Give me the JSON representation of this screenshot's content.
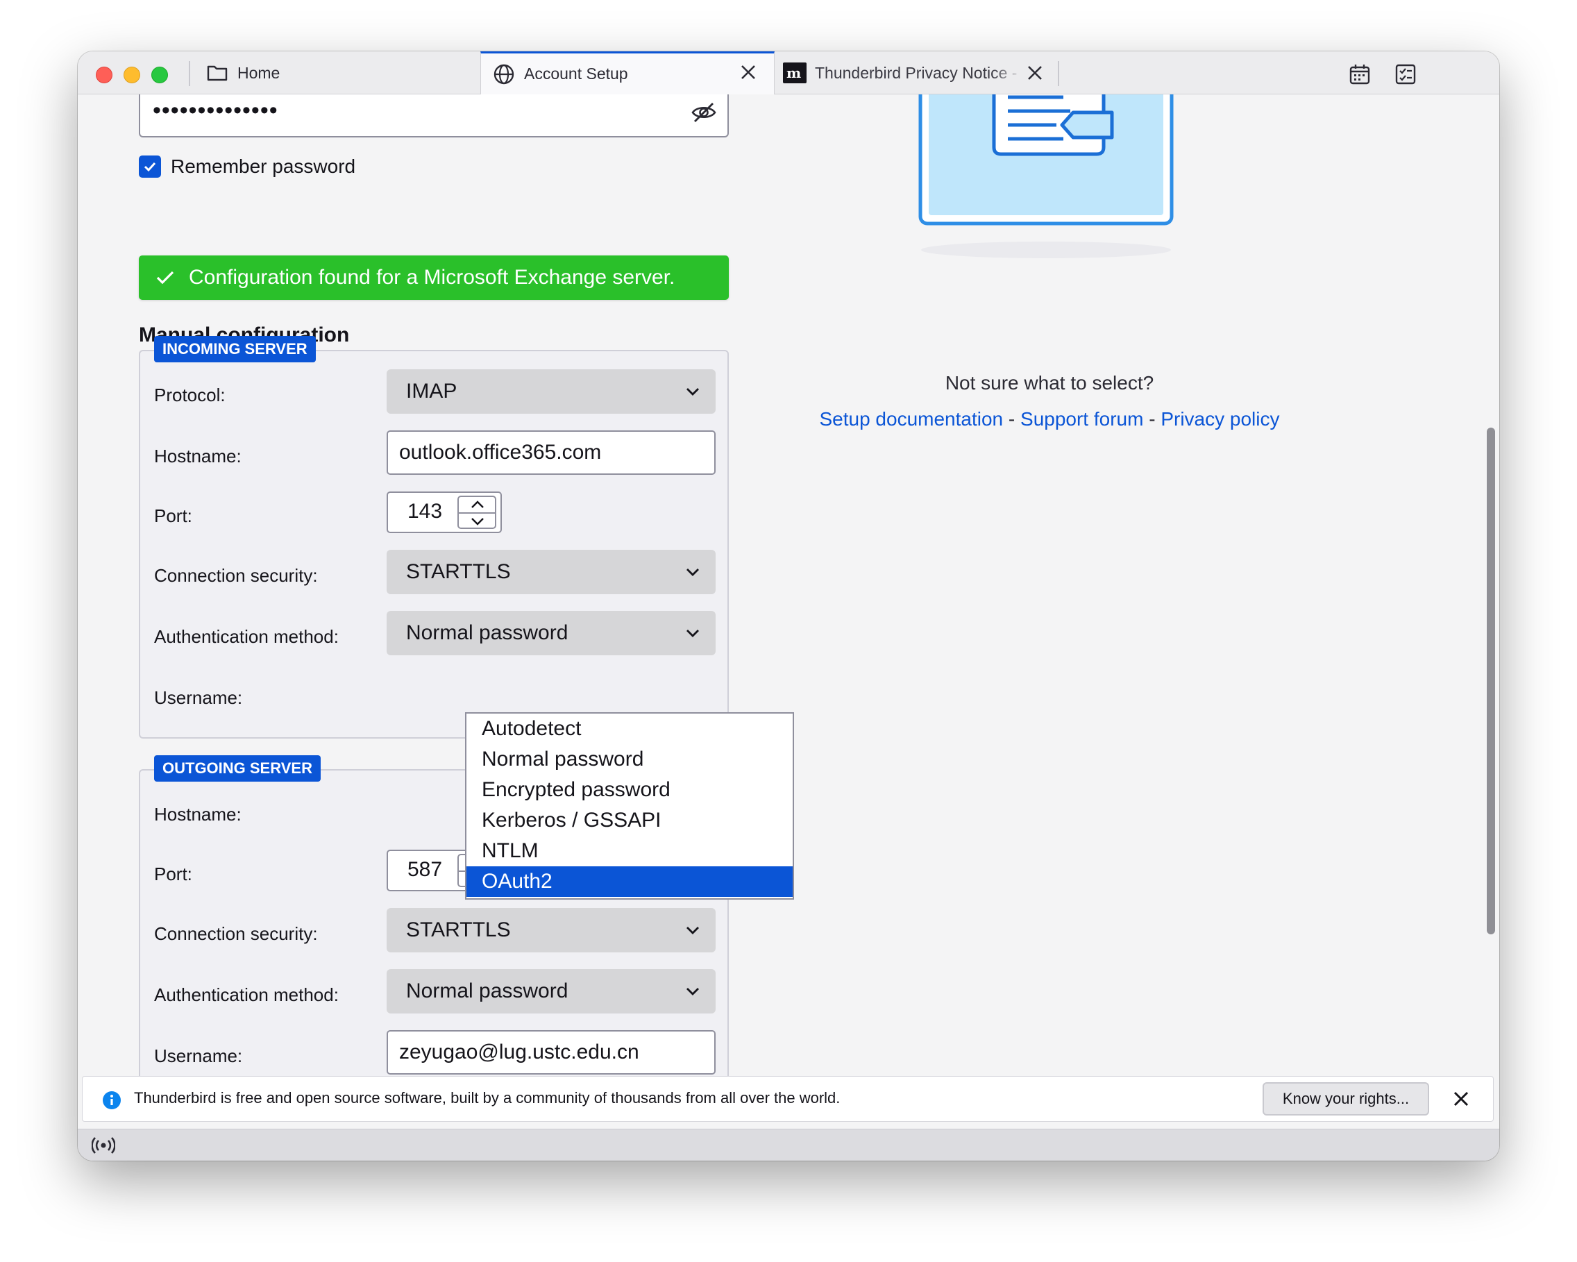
{
  "tabs": [
    {
      "label": "Home",
      "icon": "folder-icon"
    },
    {
      "label": "Account Setup",
      "icon": "globe-icon",
      "active": true
    },
    {
      "label": "Thunderbird Privacy Notice -",
      "icon": "mozilla-icon"
    }
  ],
  "password": {
    "masked": "••••••••••••••"
  },
  "remember": {
    "label": "Remember password",
    "checked": true
  },
  "banner": {
    "text": "Configuration found for a Microsoft Exchange server."
  },
  "manual": {
    "title": "Manual configuration"
  },
  "incoming": {
    "legend": "INCOMING SERVER",
    "protocol_label": "Protocol:",
    "protocol_value": "IMAP",
    "hostname_label": "Hostname:",
    "hostname_value": "outlook.office365.com",
    "port_label": "Port:",
    "port_value": "143",
    "security_label": "Connection security:",
    "security_value": "STARTTLS",
    "auth_label": "Authentication method:",
    "auth_value": "Normal password",
    "username_label": "Username:"
  },
  "auth_dropdown": {
    "options": [
      "Autodetect",
      "Normal password",
      "Encrypted password",
      "Kerberos / GSSAPI",
      "NTLM",
      "OAuth2"
    ],
    "highlighted": "OAuth2"
  },
  "outgoing": {
    "legend": "OUTGOING SERVER",
    "hostname_label": "Hostname:",
    "port_label": "Port:",
    "port_value": "587",
    "security_label": "Connection security:",
    "security_value": "STARTTLS",
    "auth_label": "Authentication method:",
    "auth_value": "Normal password",
    "username_label": "Username:",
    "username_value": "zeyugao@lug.ustc.edu.cn"
  },
  "help": {
    "question": "Not sure what to select?",
    "link_docs": "Setup documentation",
    "sep1": " - ",
    "link_forum": "Support forum",
    "sep2": " - ",
    "link_privacy": "Privacy policy"
  },
  "notification": {
    "message": "Thunderbird is free and open source software, built by a community of thousands from all over the world.",
    "button": "Know your rights..."
  },
  "colors": {
    "accent": "#0b55d6",
    "success": "#2ac02a"
  }
}
